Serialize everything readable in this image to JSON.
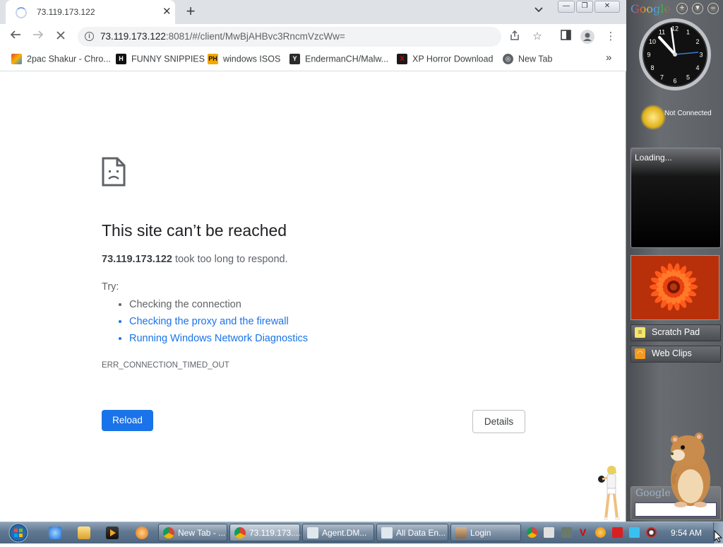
{
  "browser": {
    "tab": {
      "title": "73.119.173.122"
    },
    "address": {
      "host": "73.119.173.122",
      "rest": ":8081/#/client/MwBjAHBvc3RncmVzcWw="
    },
    "bookmarks": [
      {
        "label": "2pac Shakur - Chro...",
        "icon": "chrome-rainbow-icon",
        "color": "#e24a2f"
      },
      {
        "label": "FUNNY SNIPPIES",
        "icon": "hi-logo-icon",
        "color": "#111111"
      },
      {
        "label": "windows ISOS",
        "icon": "ph-logo-icon",
        "color": "#f2a900"
      },
      {
        "label": "EndermanCH/Malw...",
        "icon": "yp-logo-icon",
        "color": "#2b2b2b"
      },
      {
        "label": "XP Horror Download",
        "icon": "x-logo-icon",
        "color": "#c00000"
      },
      {
        "label": "New Tab",
        "icon": "globe-icon",
        "color": "#5f6368"
      }
    ]
  },
  "error_page": {
    "title": "This site can’t be reached",
    "host": "73.119.173.122",
    "description_rest": "took too long to respond.",
    "try_label": "Try:",
    "suggestions": [
      "Checking the connection",
      "Checking the proxy and the firewall",
      "Running Windows Network Diagnostics"
    ],
    "error_code": "ERR_CONNECTION_TIMED_OUT",
    "reload_label": "Reload",
    "details_label": "Details"
  },
  "sidebar": {
    "logo": "Google",
    "weather_status": "Not Connected",
    "loading_text": "Loading...",
    "gadgets": [
      {
        "label": "Scratch Pad",
        "icon": "sticky-note-icon"
      },
      {
        "label": "Web Clips",
        "icon": "rss-icon"
      }
    ],
    "search_logo": "Google",
    "clock": {
      "numbers": [
        "12",
        "1",
        "2",
        "3",
        "4",
        "5",
        "6",
        "7",
        "8",
        "9",
        "10",
        "11"
      ]
    }
  },
  "taskbar": {
    "tasks": [
      {
        "label": "New Tab - ...",
        "icon": "chrome-icon",
        "active": false
      },
      {
        "label": "73.119.173....",
        "icon": "chrome-icon",
        "active": true
      },
      {
        "label": "Agent.DM...",
        "icon": "window-icon",
        "active": false
      },
      {
        "label": "All Data En...",
        "icon": "window-icon",
        "active": false
      },
      {
        "label": "Login",
        "icon": "login-icon",
        "active": false
      }
    ],
    "clock": "9:54 AM"
  }
}
